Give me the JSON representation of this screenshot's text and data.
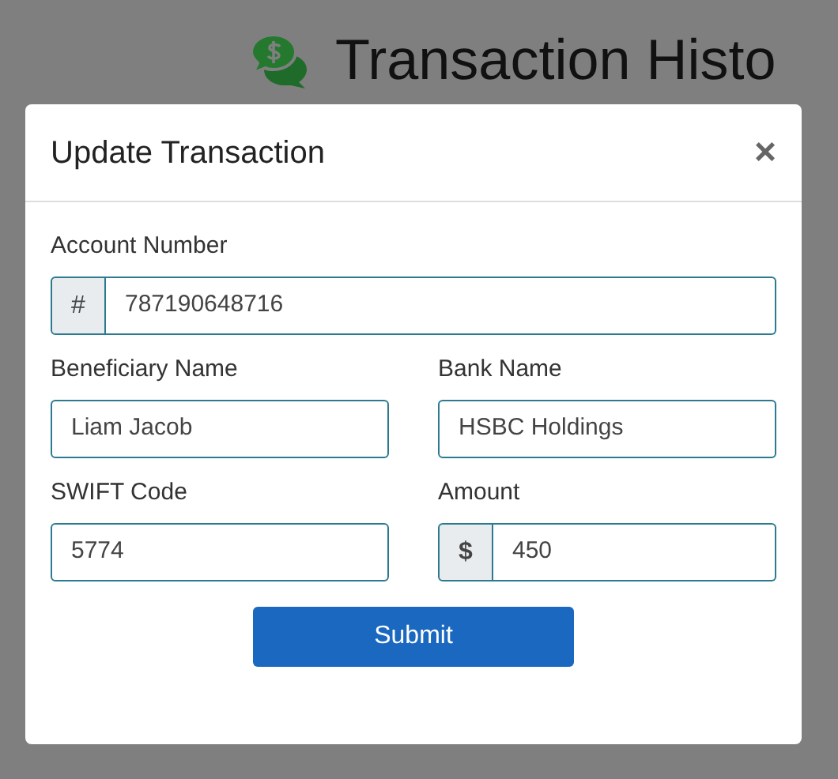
{
  "page": {
    "title": "Transaction Histo"
  },
  "modal": {
    "title": "Update Transaction",
    "close": "×",
    "rows": [
      [
        {
          "label": "Account Number",
          "kind": "prefixed",
          "prefix": "#",
          "value": "787190648716"
        }
      ],
      [
        {
          "label": "Beneficiary Name",
          "kind": "plain",
          "value": "Liam Jacob"
        },
        {
          "label": "Bank Name",
          "kind": "plain",
          "value": "HSBC Holdings"
        }
      ],
      [
        {
          "label": "SWIFT Code",
          "kind": "plain",
          "value": "5774"
        },
        {
          "label": "Amount",
          "kind": "prefixed",
          "prefix": "$",
          "value": "450"
        }
      ]
    ],
    "submit": "Submit"
  }
}
